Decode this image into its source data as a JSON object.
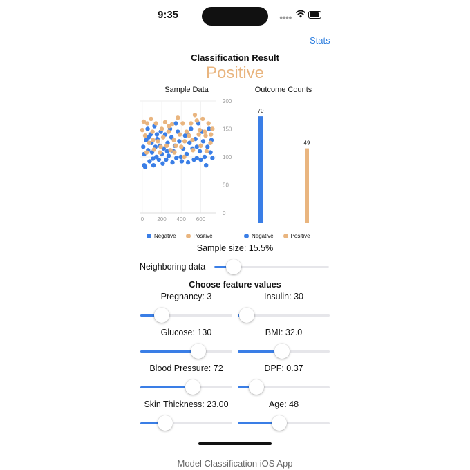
{
  "status_bar": {
    "time": "9:35"
  },
  "nav": {
    "stats_label": "Stats"
  },
  "result": {
    "title": "Classification Result",
    "value": "Positive"
  },
  "colors": {
    "negative": "#3a7ee6",
    "positive": "#e9b57f",
    "accent": "#2f7fdf"
  },
  "charts": {
    "sample_title": "Sample Data",
    "counts_title": "Outcome Counts",
    "legend_negative": "Negative",
    "legend_positive": "Positive"
  },
  "chart_data": [
    {
      "type": "scatter",
      "title": "Sample Data",
      "xlabel": "",
      "ylabel": "",
      "xlim": [
        -20,
        760
      ],
      "ylim": [
        0,
        200
      ],
      "x_ticks": [
        "0",
        "200",
        "400",
        "600"
      ],
      "y_ticks": [
        "0",
        "50",
        "100",
        "150",
        "200"
      ],
      "grid": true,
      "legend_position": "bottom",
      "series": [
        {
          "name": "Negative",
          "color": "#3a7ee6",
          "points": [
            [
              10,
              118
            ],
            [
              20,
              105
            ],
            [
              30,
              82
            ],
            [
              40,
              130
            ],
            [
              55,
              150
            ],
            [
              65,
              135
            ],
            [
              75,
              92
            ],
            [
              85,
              140
            ],
            [
              95,
              125
            ],
            [
              100,
              108
            ],
            [
              110,
              97
            ],
            [
              115,
              85
            ],
            [
              125,
              155
            ],
            [
              135,
              118
            ],
            [
              145,
              100
            ],
            [
              155,
              132
            ],
            [
              170,
              95
            ],
            [
              180,
              120
            ],
            [
              190,
              145
            ],
            [
              200,
              105
            ],
            [
              210,
              88
            ],
            [
              220,
              115
            ],
            [
              235,
              140
            ],
            [
              245,
              95
            ],
            [
              260,
              125
            ],
            [
              270,
              102
            ],
            [
              285,
              150
            ],
            [
              300,
              135
            ],
            [
              310,
              90
            ],
            [
              320,
              110
            ],
            [
              335,
              120
            ],
            [
              350,
              98
            ],
            [
              365,
              145
            ],
            [
              380,
              128
            ],
            [
              395,
              100
            ],
            [
              405,
              92
            ],
            [
              420,
              115
            ],
            [
              440,
              138
            ],
            [
              455,
              105
            ],
            [
              470,
              90
            ],
            [
              485,
              125
            ],
            [
              500,
              150
            ],
            [
              515,
              115
            ],
            [
              530,
              95
            ],
            [
              545,
              132
            ],
            [
              560,
              118
            ],
            [
              575,
              160
            ],
            [
              590,
              110
            ],
            [
              600,
              95
            ],
            [
              615,
              145
            ],
            [
              625,
              128
            ],
            [
              640,
              100
            ],
            [
              655,
              85
            ],
            [
              670,
              118
            ],
            [
              685,
              150
            ],
            [
              700,
              108
            ],
            [
              710,
              130
            ],
            [
              720,
              98
            ],
            [
              60,
              112
            ],
            [
              150,
              140
            ],
            [
              255,
              110
            ],
            [
              345,
              160
            ],
            [
              470,
              140
            ],
            [
              560,
              98
            ],
            [
              20,
              85
            ]
          ]
        },
        {
          "name": "Positive",
          "color": "#e9b57f",
          "points": [
            [
              0,
              148
            ],
            [
              15,
              163
            ],
            [
              30,
              138
            ],
            [
              50,
              160
            ],
            [
              70,
              125
            ],
            [
              90,
              168
            ],
            [
              105,
              145
            ],
            [
              120,
              113
            ],
            [
              140,
              160
            ],
            [
              160,
              128
            ],
            [
              180,
              108
            ],
            [
              200,
              150
            ],
            [
              215,
              135
            ],
            [
              235,
              162
            ],
            [
              250,
              120
            ],
            [
              270,
              145
            ],
            [
              290,
              112
            ],
            [
              305,
              158
            ],
            [
              325,
              130
            ],
            [
              345,
              120
            ],
            [
              365,
              170
            ],
            [
              385,
              140
            ],
            [
              400,
              118
            ],
            [
              415,
              160
            ],
            [
              435,
              128
            ],
            [
              455,
              145
            ],
            [
              480,
              138
            ],
            [
              500,
              160
            ],
            [
              520,
              112
            ],
            [
              540,
              175
            ],
            [
              560,
              165
            ],
            [
              580,
              140
            ],
            [
              600,
              120
            ],
            [
              620,
              168
            ],
            [
              640,
              145
            ],
            [
              660,
              110
            ],
            [
              680,
              160
            ],
            [
              700,
              125
            ],
            [
              720,
              150
            ],
            [
              45,
              108
            ],
            [
              110,
              130
            ],
            [
              275,
              155
            ],
            [
              430,
              100
            ],
            [
              590,
              148
            ],
            [
              650,
              138
            ],
            [
              705,
              140
            ],
            [
              190,
              118
            ],
            [
              330,
              108
            ],
            [
              515,
              130
            ]
          ]
        }
      ]
    },
    {
      "type": "bar",
      "title": "Outcome Counts",
      "categories": [
        "Negative",
        "Positive"
      ],
      "values": [
        70,
        49
      ],
      "data_labels": [
        "70",
        "49"
      ],
      "colors": [
        "#3a7ee6",
        "#e9b57f"
      ],
      "ylim": [
        0,
        80
      ],
      "legend_position": "bottom"
    }
  ],
  "sample_size": "Sample size: 15.5%",
  "neighbors": {
    "label": "Neighboring data",
    "fraction": 0.17
  },
  "features": {
    "title": "Choose feature values",
    "items": [
      {
        "label": "Pregnancy: 3",
        "fraction": 0.23
      },
      {
        "label": "Insulin: 30",
        "fraction": 0.1
      },
      {
        "label": "Glucose: 130",
        "fraction": 0.63
      },
      {
        "label": "BMI: 32.0",
        "fraction": 0.48
      },
      {
        "label": "Blood Pressure: 72",
        "fraction": 0.57
      },
      {
        "label": "DPF: 0.37",
        "fraction": 0.2
      },
      {
        "label": "Skin Thickness: 23.00",
        "fraction": 0.27
      },
      {
        "label": "Age: 48",
        "fraction": 0.45
      }
    ]
  },
  "caption": "Model Classification iOS App"
}
